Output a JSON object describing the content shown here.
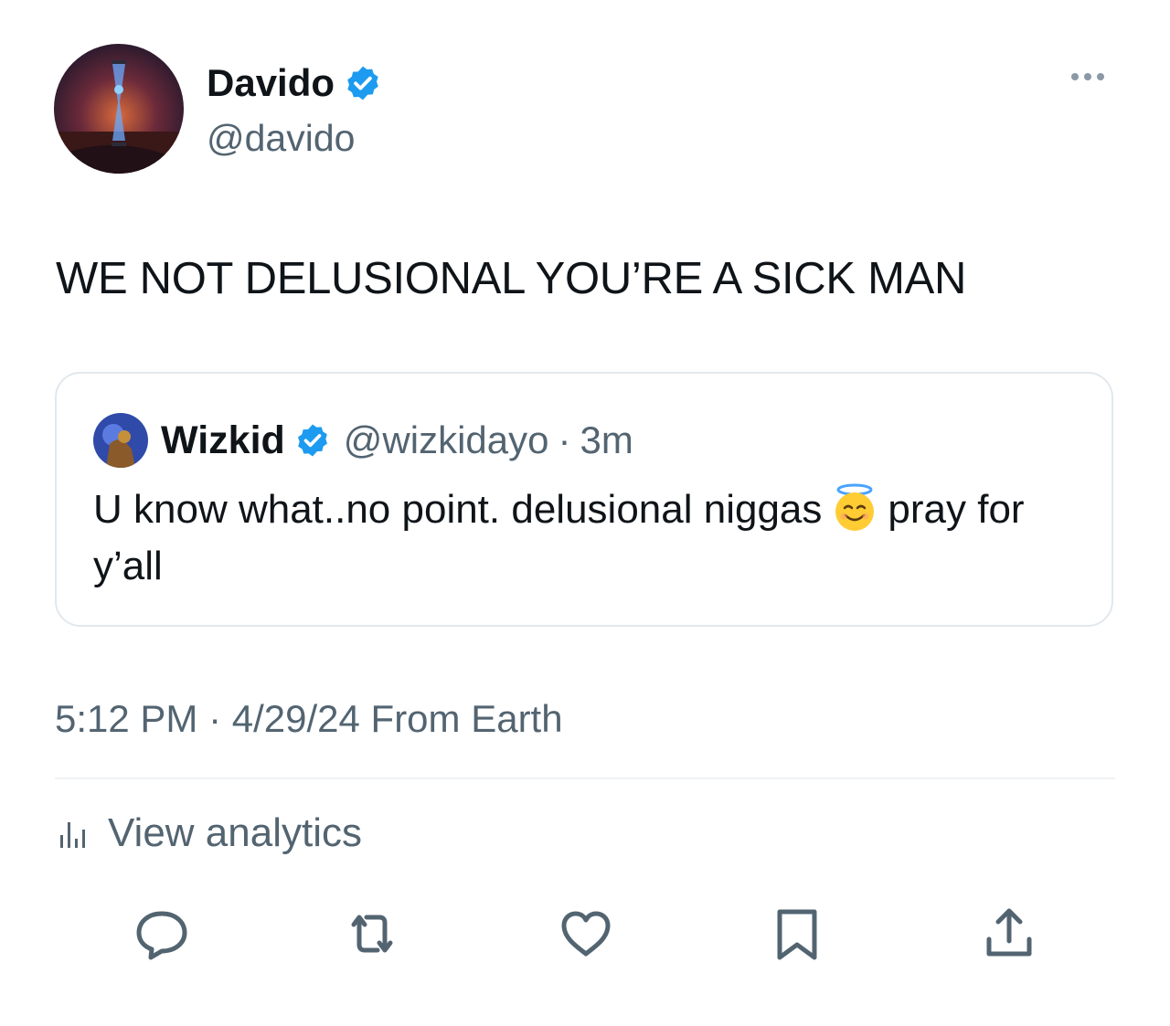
{
  "author": {
    "name": "Davido",
    "handle": "@davido",
    "verified_color": "#1d9bf0"
  },
  "tweet": {
    "text": "WE NOT DELUSIONAL YOU’RE A SICK MAN"
  },
  "quoted": {
    "name": "Wizkid",
    "handle": "@wizkidayo",
    "separator": "·",
    "time": "3m",
    "text_part1": "U know what..no point. delusional niggas",
    "emoji": "smiling-face-with-halo",
    "text_part2": "pray for y’all"
  },
  "meta": {
    "text": "5:12 PM · 4/29/24 From Earth"
  },
  "analytics": {
    "label": "View analytics"
  },
  "actions": [
    "reply-icon",
    "retweet-icon",
    "like-icon",
    "bookmark-icon",
    "share-icon"
  ]
}
